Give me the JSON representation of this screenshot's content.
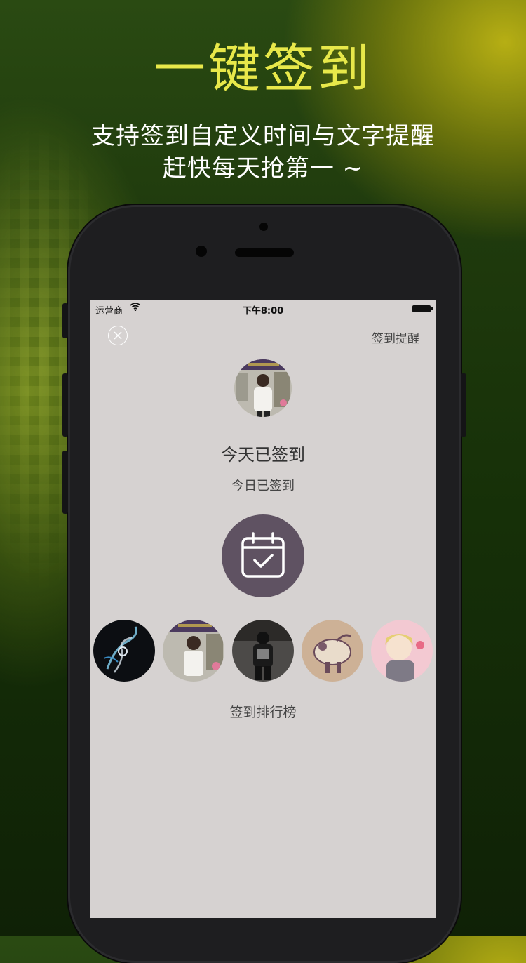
{
  "promo": {
    "headline": "一键签到",
    "subtitle_line1": "支持签到自定义时间与文字提醒",
    "subtitle_line2": "赶快每天抢第一 ~"
  },
  "status_bar": {
    "carrier": "运营商",
    "time": "下午8:00"
  },
  "header": {
    "close_icon": "close-icon",
    "remind_label": "签到提醒"
  },
  "profile": {
    "title": "今天已签到",
    "subtitle": "今日已签到"
  },
  "checkin": {
    "icon": "calendar-check-icon",
    "color": "#5f5262"
  },
  "ranking": {
    "label": "签到排行榜",
    "avatars": [
      "avatar-1",
      "avatar-2",
      "avatar-3",
      "avatar-4",
      "avatar-5"
    ]
  },
  "colors": {
    "headline": "#e8e84a",
    "screen_bg": "#d6d2d1"
  }
}
